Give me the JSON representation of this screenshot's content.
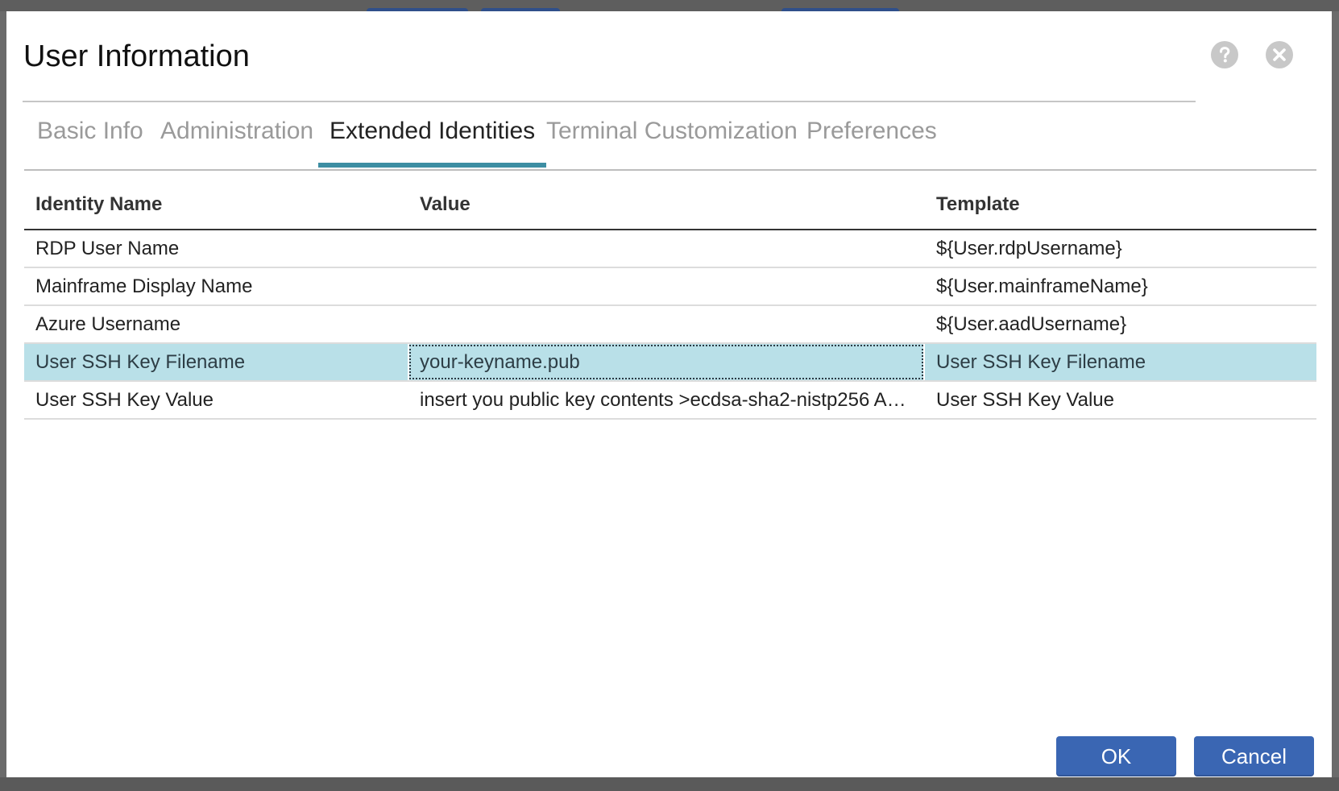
{
  "dialog": {
    "title": "User Information",
    "help_icon": "question-circle-icon",
    "close_icon": "close-circle-icon"
  },
  "tabs": [
    {
      "label": "Basic Info",
      "active": false
    },
    {
      "label": "Administration",
      "active": false
    },
    {
      "label": "Extended Identities",
      "active": true
    },
    {
      "label": "Terminal Customization",
      "active": false
    },
    {
      "label": "Preferences",
      "active": false
    }
  ],
  "grid": {
    "columns": [
      "Identity Name",
      "Value",
      "Template"
    ],
    "rows": [
      {
        "name": "RDP User Name",
        "value": "",
        "template": "${User.rdpUsername}",
        "selected": false
      },
      {
        "name": "Mainframe Display Name",
        "value": "",
        "template": "${User.mainframeName}",
        "selected": false
      },
      {
        "name": "Azure Username",
        "value": "",
        "template": "${User.aadUsername}",
        "selected": false
      },
      {
        "name": "User SSH Key Filename",
        "value": "your-keyname.pub",
        "template": "User SSH Key Filename",
        "selected": true
      },
      {
        "name": "User SSH Key Value",
        "value": "insert you public key contents >ecdsa-sha2-nistp256 A…",
        "template": "User SSH Key Value",
        "selected": false
      }
    ]
  },
  "buttons": {
    "ok_label": "OK",
    "cancel_label": "Cancel"
  },
  "colors": {
    "accent_tab": "#3d8ea3",
    "selected_row": "#b9e0e8",
    "primary_button": "#3a66b3"
  }
}
